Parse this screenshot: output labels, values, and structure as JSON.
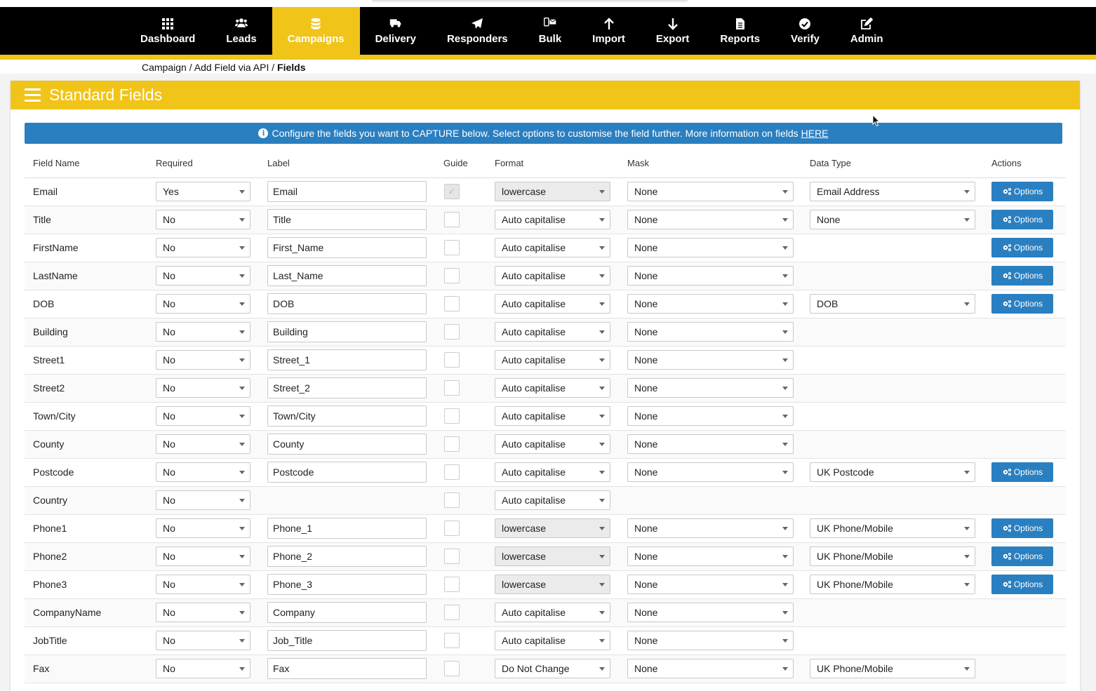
{
  "nav": {
    "items": [
      {
        "label": "Dashboard",
        "icon": "grid-icon",
        "active": false
      },
      {
        "label": "Leads",
        "icon": "users-icon",
        "active": false
      },
      {
        "label": "Campaigns",
        "icon": "database-icon",
        "active": true
      },
      {
        "label": "Delivery",
        "icon": "truck-icon",
        "active": false
      },
      {
        "label": "Responders",
        "icon": "paper-plane-icon",
        "active": false
      },
      {
        "label": "Bulk",
        "icon": "mobile-envelope-icon",
        "active": false
      },
      {
        "label": "Import",
        "icon": "arrow-up-icon",
        "active": false
      },
      {
        "label": "Export",
        "icon": "arrow-down-icon",
        "active": false
      },
      {
        "label": "Reports",
        "icon": "file-icon",
        "active": false
      },
      {
        "label": "Verify",
        "icon": "check-circle-icon",
        "active": false
      },
      {
        "label": "Admin",
        "icon": "edit-icon",
        "active": false
      }
    ],
    "accent": "#f0c419"
  },
  "breadcrumb": {
    "part1": "Campaign",
    "sep1": " / ",
    "part2": "Add Field via API",
    "sep2": " / ",
    "current": "Fields"
  },
  "panel": {
    "title": "Standard Fields"
  },
  "info": {
    "text": "Configure the fields you want to CAPTURE below. Select options to customise the field further. More information on fields",
    "link": "HERE",
    "color": "#2a7fc1"
  },
  "table": {
    "headers": [
      "Field Name",
      "Required",
      "Label",
      "Guide",
      "Format",
      "Mask",
      "Data Type",
      "Actions"
    ],
    "options_label": "Options",
    "rows": [
      {
        "field": "Email",
        "required": "Yes",
        "label": "Email",
        "guide": "disabled",
        "format": "lowercase",
        "format_disabled": true,
        "mask": "None",
        "datatype": "Email Address",
        "options": true
      },
      {
        "field": "Title",
        "required": "No",
        "label": "Title",
        "guide": "off",
        "format": "Auto capitalise",
        "format_disabled": false,
        "mask": "None",
        "datatype": "None",
        "options": true
      },
      {
        "field": "FirstName",
        "required": "No",
        "label": "First_Name",
        "guide": "off",
        "format": "Auto capitalise",
        "format_disabled": false,
        "mask": "None",
        "datatype": "",
        "options": true
      },
      {
        "field": "LastName",
        "required": "No",
        "label": "Last_Name",
        "guide": "off",
        "format": "Auto capitalise",
        "format_disabled": false,
        "mask": "None",
        "datatype": "",
        "options": true
      },
      {
        "field": "DOB",
        "required": "No",
        "label": "DOB",
        "guide": "off",
        "format": "Auto capitalise",
        "format_disabled": false,
        "mask": "None",
        "datatype": "DOB",
        "options": true
      },
      {
        "field": "Building",
        "required": "No",
        "label": "Building",
        "guide": "off",
        "format": "Auto capitalise",
        "format_disabled": false,
        "mask": "None",
        "datatype": "",
        "options": false
      },
      {
        "field": "Street1",
        "required": "No",
        "label": "Street_1",
        "guide": "off",
        "format": "Auto capitalise",
        "format_disabled": false,
        "mask": "None",
        "datatype": "",
        "options": false
      },
      {
        "field": "Street2",
        "required": "No",
        "label": "Street_2",
        "guide": "off",
        "format": "Auto capitalise",
        "format_disabled": false,
        "mask": "None",
        "datatype": "",
        "options": false
      },
      {
        "field": "Town/City",
        "required": "No",
        "label": "Town/City",
        "guide": "off",
        "format": "Auto capitalise",
        "format_disabled": false,
        "mask": "None",
        "datatype": "",
        "options": false
      },
      {
        "field": "County",
        "required": "No",
        "label": "County",
        "guide": "off",
        "format": "Auto capitalise",
        "format_disabled": false,
        "mask": "None",
        "datatype": "",
        "options": false
      },
      {
        "field": "Postcode",
        "required": "No",
        "label": "Postcode",
        "guide": "off",
        "format": "Auto capitalise",
        "format_disabled": false,
        "mask": "None",
        "datatype": "UK Postcode",
        "options": true
      },
      {
        "field": "Country",
        "required": "No",
        "label": "",
        "guide": "off",
        "format": "Auto capitalise",
        "format_disabled": false,
        "mask": "",
        "datatype": "",
        "options": false
      },
      {
        "field": "Phone1",
        "required": "No",
        "label": "Phone_1",
        "guide": "off",
        "format": "lowercase",
        "format_disabled": true,
        "mask": "None",
        "datatype": "UK Phone/Mobile",
        "options": true
      },
      {
        "field": "Phone2",
        "required": "No",
        "label": "Phone_2",
        "guide": "off",
        "format": "lowercase",
        "format_disabled": true,
        "mask": "None",
        "datatype": "UK Phone/Mobile",
        "options": true
      },
      {
        "field": "Phone3",
        "required": "No",
        "label": "Phone_3",
        "guide": "off",
        "format": "lowercase",
        "format_disabled": true,
        "mask": "None",
        "datatype": "UK Phone/Mobile",
        "options": true
      },
      {
        "field": "CompanyName",
        "required": "No",
        "label": "Company",
        "guide": "off",
        "format": "Auto capitalise",
        "format_disabled": false,
        "mask": "None",
        "datatype": "",
        "options": false
      },
      {
        "field": "JobTitle",
        "required": "No",
        "label": "Job_Title",
        "guide": "off",
        "format": "Auto capitalise",
        "format_disabled": false,
        "mask": "None",
        "datatype": "",
        "options": false
      },
      {
        "field": "Fax",
        "required": "No",
        "label": "Fax",
        "guide": "off",
        "format": "Do Not Change",
        "format_disabled": false,
        "mask": "None",
        "datatype": "UK Phone/Mobile",
        "options": false
      }
    ]
  }
}
